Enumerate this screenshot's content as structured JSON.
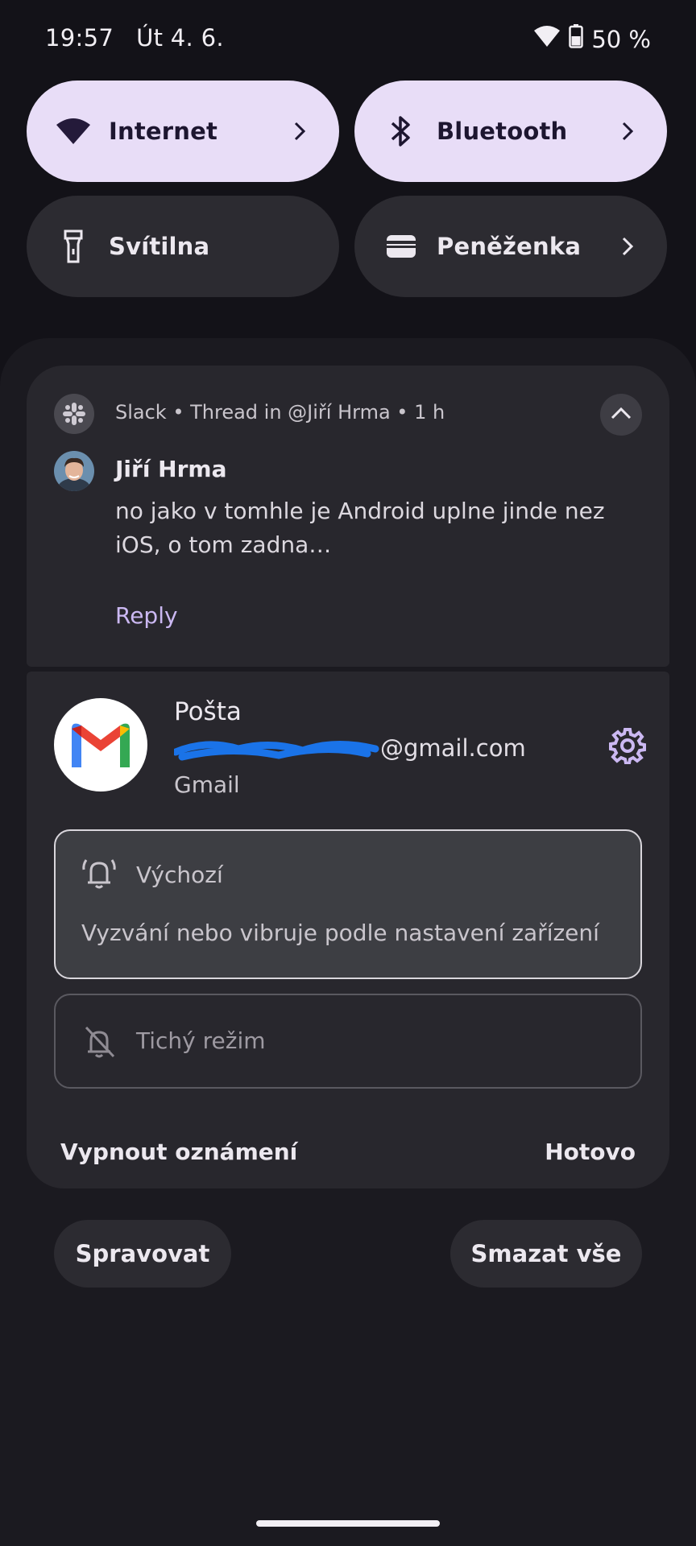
{
  "status_bar": {
    "time": "19:57",
    "date": "Út 4. 6.",
    "battery": "50 %",
    "icons": [
      "wifi-icon",
      "battery-icon"
    ]
  },
  "quick_settings": [
    {
      "label": "Internet",
      "icon": "wifi-icon",
      "state": "on",
      "chevron": true
    },
    {
      "label": "Bluetooth",
      "icon": "bluetooth-icon",
      "state": "on",
      "chevron": true
    },
    {
      "label": "Svítilna",
      "icon": "flashlight-icon",
      "state": "off",
      "chevron": false
    },
    {
      "label": "Peněženka",
      "icon": "wallet-icon",
      "state": "off",
      "chevron": true
    }
  ],
  "slack_notification": {
    "app_icon": "slack-icon",
    "meta": "Slack • Thread in @Jiří Hrma • 1 h",
    "sender": "Jiří Hrma",
    "message": "no jako v tomhle je Android uplne jinde nez iOS, o tom zadna…",
    "reply_label": "Reply"
  },
  "gmail_settings": {
    "app_icon": "gmail-icon",
    "app_name": "Pošta",
    "account_suffix": "@gmail.com",
    "sub": "Gmail",
    "options": [
      {
        "title": "Výchozí",
        "description": "Vyzvání nebo vibruje podle nastavení zařízení",
        "icon": "bell-ring-icon",
        "selected": true
      },
      {
        "title": "Tichý režim",
        "icon": "bell-off-icon",
        "selected": false
      }
    ],
    "turn_off_label": "Vypnout oznámení",
    "done_label": "Hotovo"
  },
  "bottom_actions": {
    "manage_label": "Spravovat",
    "clear_all_label": "Smazat vše"
  },
  "colors": {
    "background": "#131218",
    "tile_on": "#e8ddf7",
    "tile_off": "#2c2b31",
    "card": "#28272d",
    "accent": "#cbb8f2"
  }
}
